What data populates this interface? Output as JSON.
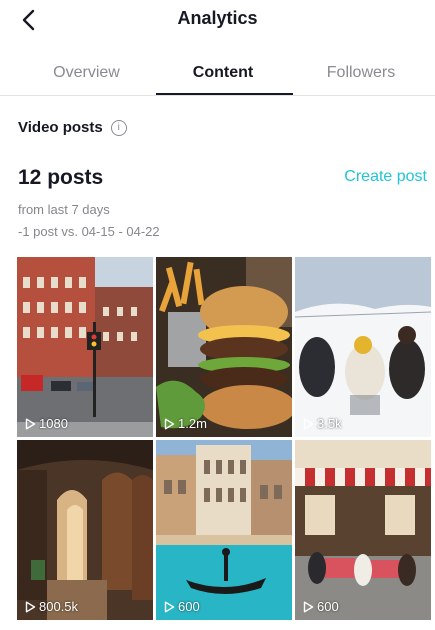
{
  "header": {
    "title": "Analytics",
    "back_icon": "chevron-left-icon"
  },
  "tabs": [
    {
      "label": "Overview",
      "active": false
    },
    {
      "label": "Content",
      "active": true
    },
    {
      "label": "Followers",
      "active": false
    }
  ],
  "section": {
    "label": "Video posts",
    "info_icon": "info-icon"
  },
  "summary": {
    "count": "12 posts",
    "create_label": "Create post",
    "period": "from last 7 days",
    "comparison": "-1 post vs. 04-15 - 04-22"
  },
  "accent_color": "#20c4d8",
  "videos": [
    {
      "views": "1080",
      "scene": "city-street"
    },
    {
      "views": "1.2m",
      "scene": "burger"
    },
    {
      "views": "3.5k",
      "scene": "snow-people"
    },
    {
      "views": "800.5k",
      "scene": "arcade"
    },
    {
      "views": "600",
      "scene": "gondola-canal"
    },
    {
      "views": "600",
      "scene": "cafe"
    }
  ],
  "play_icon": "play-outline-icon"
}
